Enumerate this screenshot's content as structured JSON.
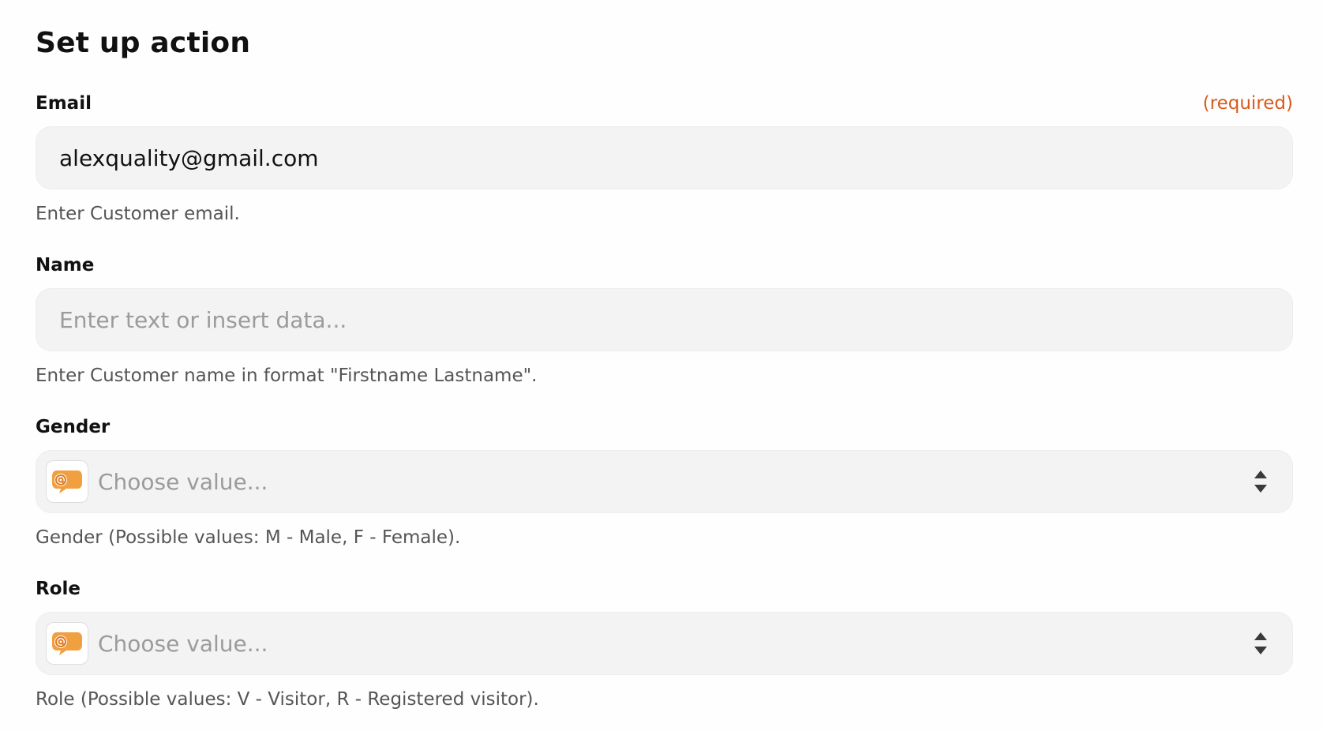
{
  "page": {
    "title": "Set up action"
  },
  "fields": {
    "email": {
      "label": "Email",
      "required_text": "(required)",
      "value": "alexquality@gmail.com",
      "help": "Enter Customer email."
    },
    "name": {
      "label": "Name",
      "placeholder": "Enter text or insert data...",
      "help": "Enter Customer name in format \"Firstname Lastname\"."
    },
    "gender": {
      "label": "Gender",
      "placeholder": "Choose value...",
      "help": "Gender (Possible values: M - Male, F - Female)."
    },
    "role": {
      "label": "Role",
      "placeholder": "Choose value...",
      "help": "Role (Possible values: V - Visitor, R - Registered visitor)."
    }
  },
  "icons": {
    "app": "chat-bubble-at-icon",
    "select_arrows": "sort-arrows-icon"
  },
  "colors": {
    "required": "#d85a1c",
    "app_icon": "#f0a040",
    "input_bg": "#f3f3f3"
  }
}
